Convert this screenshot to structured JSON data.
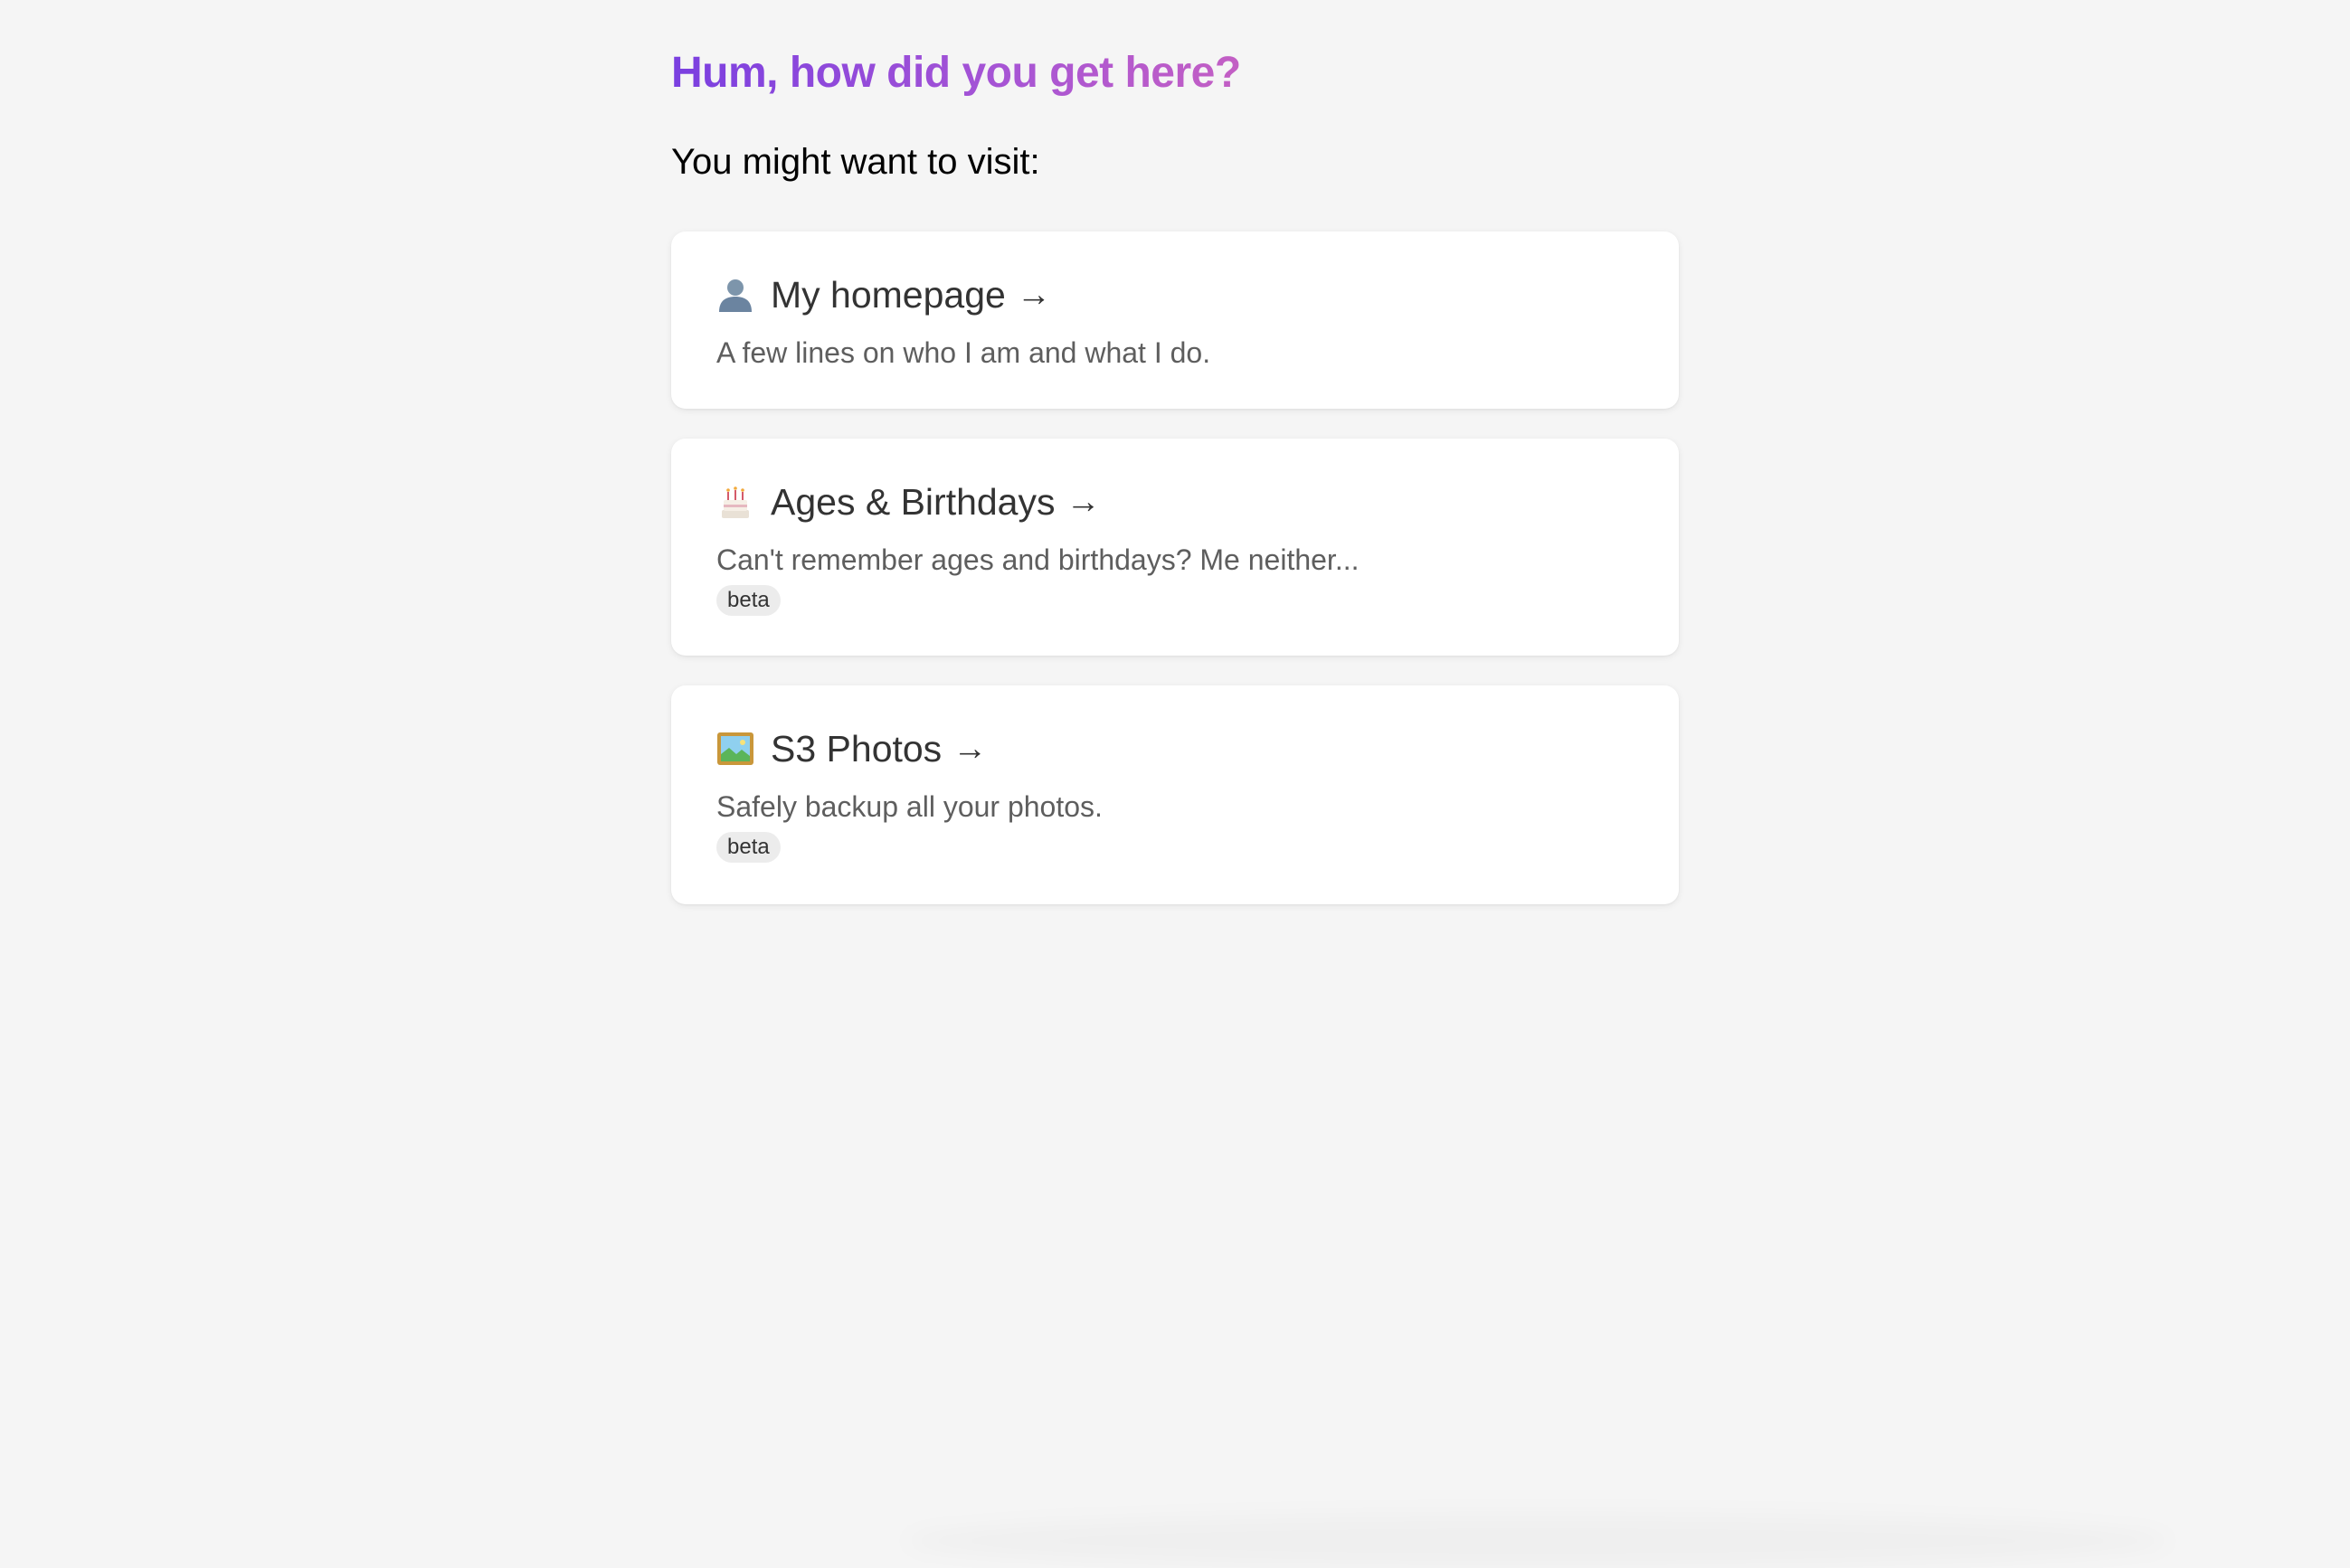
{
  "header": {
    "title": "Hum, how did you get here?",
    "subtitle": "You might want to visit:"
  },
  "colors": {
    "background": "#f5f5f5",
    "card_background": "#ffffff",
    "title_gradient_start": "#7a3fe0",
    "title_gradient_end": "#c35fc4",
    "badge_background": "#ececec",
    "text_primary": "#333333",
    "text_secondary": "#5e5e5e"
  },
  "links": [
    {
      "icon": "person-silhouette-icon",
      "label": "My homepage",
      "arrow": "→",
      "description": "A few lines on who I am and what I do.",
      "badge": null
    },
    {
      "icon": "birthday-cake-icon",
      "label": "Ages & Birthdays",
      "arrow": "→",
      "description": "Can't remember ages and birthdays? Me neither...",
      "badge": "beta"
    },
    {
      "icon": "framed-picture-icon",
      "label": "S3 Photos",
      "arrow": "→",
      "description": "Safely backup all your photos.",
      "badge": "beta"
    }
  ]
}
